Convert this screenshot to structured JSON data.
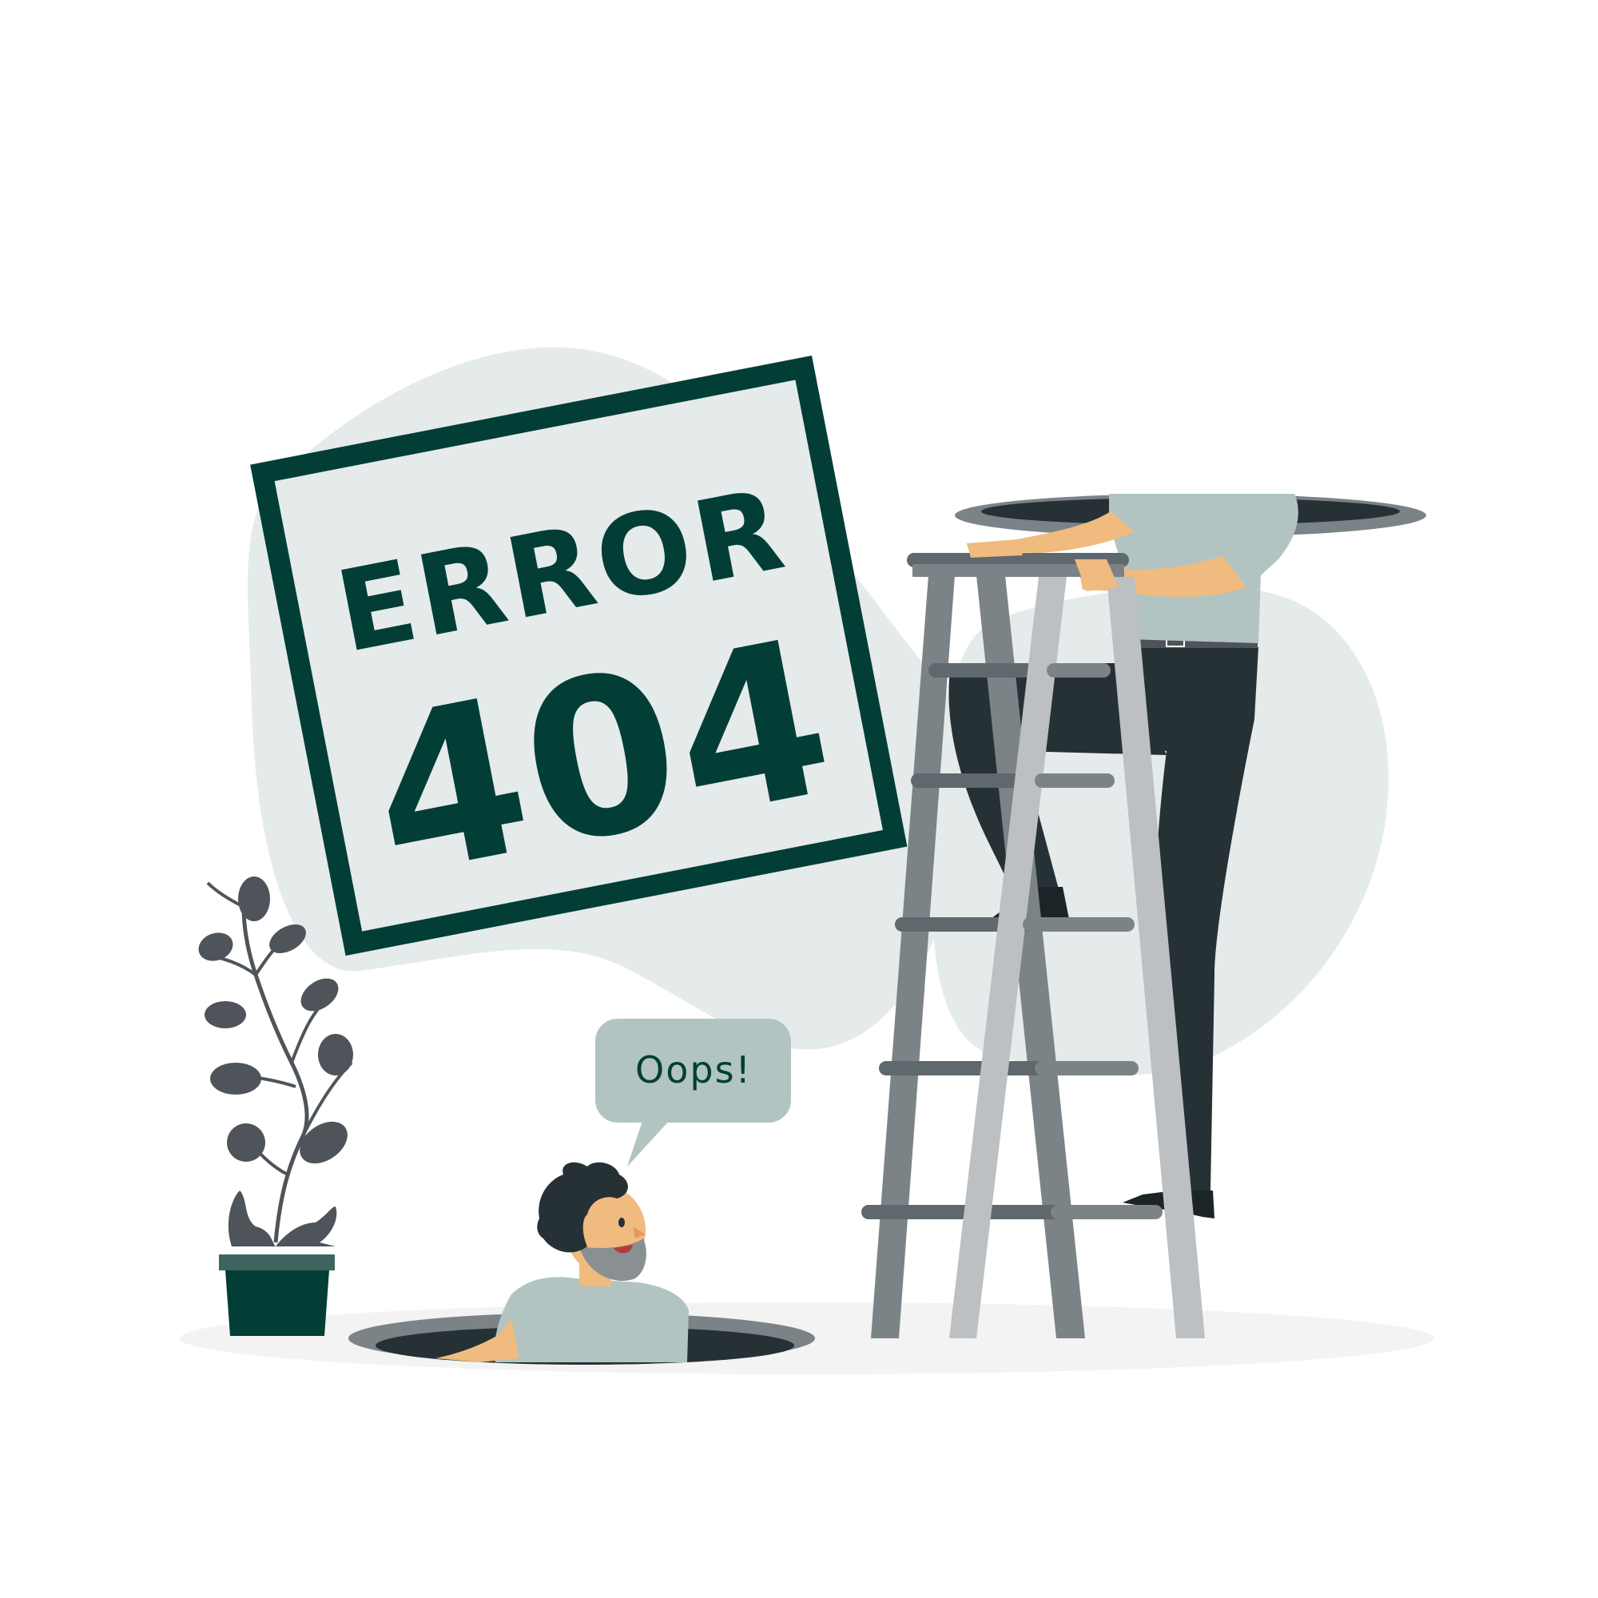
{
  "sign": {
    "line1": "ERROR",
    "line2": "404"
  },
  "speech_bubble": {
    "text": "Oops!"
  },
  "colors": {
    "dark_green": "#023e36",
    "blob_light": "#e5eaea",
    "shirt": "#b1c4c1",
    "skin": "#efbb7f",
    "pants": "#263136",
    "ladder_dark": "#7b8387",
    "ladder_light": "#bcc0c3",
    "plant_leaf": "#4e5459",
    "ground_shadow": "#f3f3f3"
  },
  "icons": {
    "plant": "potted-plant-icon",
    "ladder": "ladder-icon"
  }
}
